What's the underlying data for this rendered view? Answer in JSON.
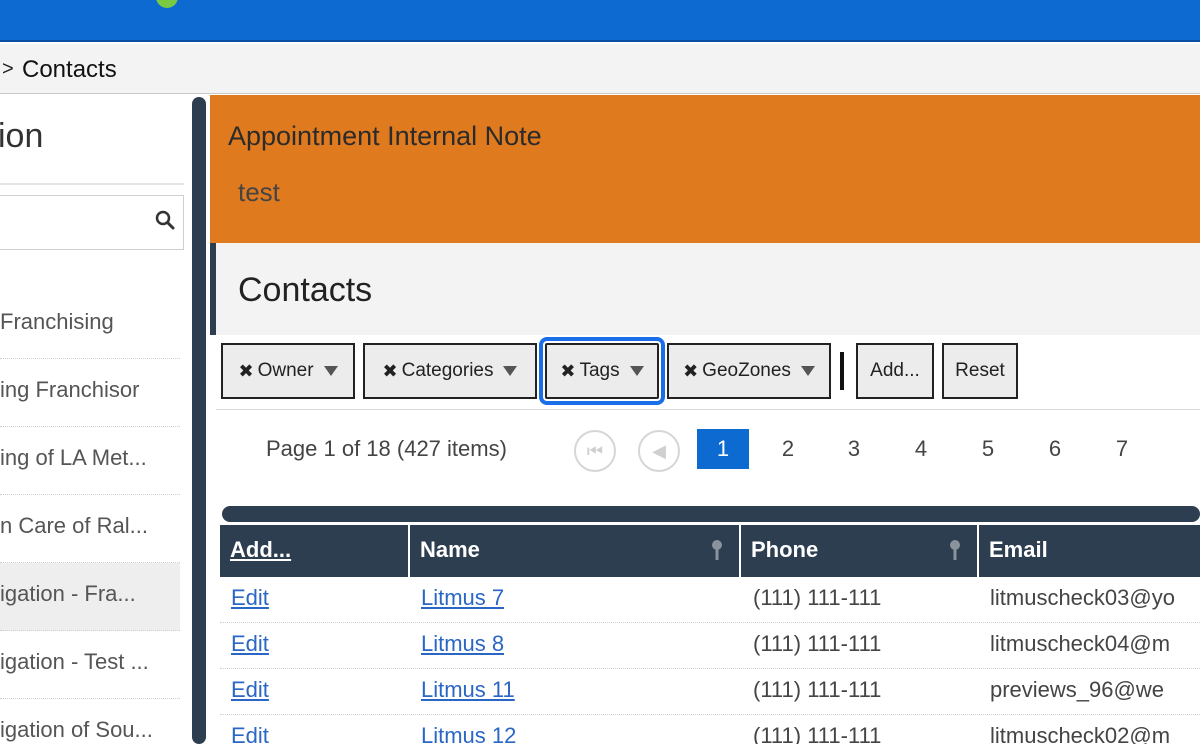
{
  "breadcrumb": {
    "separator": ">",
    "current": "Contacts"
  },
  "left_panel": {
    "title": "ion",
    "search": {
      "placeholder": ""
    },
    "items": [
      {
        "label": "Franchising"
      },
      {
        "label": "ing Franchisor"
      },
      {
        "label": "ing of LA Met..."
      },
      {
        "label": "n Care of Ral..."
      },
      {
        "label": "igation - Fra..."
      },
      {
        "label": "igation - Test ..."
      },
      {
        "label": "igation of Sou..."
      }
    ]
  },
  "notice": {
    "title": "Appointment Internal Note",
    "body": "test"
  },
  "contacts": {
    "title": "Contacts"
  },
  "filters": {
    "owner": "Owner",
    "categories": "Categories",
    "tags": "Tags",
    "geozones": "GeoZones",
    "add": "Add...",
    "reset": "Reset",
    "remove_glyph": "✖"
  },
  "pager": {
    "info": "Page 1 of 18 (427 items)",
    "first_glyph": "⏮",
    "prev_glyph": "◀",
    "pages": [
      "1",
      "2",
      "3",
      "4",
      "5",
      "6",
      "7"
    ],
    "current": "1"
  },
  "grid": {
    "columns": {
      "add": "Add...",
      "name": "Name",
      "phone": "Phone",
      "email": "Email"
    },
    "rows": [
      {
        "edit": "Edit",
        "name": "Litmus 7",
        "phone": "(111) 111-111",
        "email": "litmuscheck03@yo"
      },
      {
        "edit": "Edit",
        "name": "Litmus 8",
        "phone": "(111) 111-111",
        "email": "litmuscheck04@m"
      },
      {
        "edit": "Edit",
        "name": "Litmus 11",
        "phone": "(111) 111-111",
        "email": "previews_96@we"
      },
      {
        "edit": "Edit",
        "name": "Litmus 12",
        "phone": "(111) 111-111",
        "email": "litmuscheck02@m"
      }
    ]
  },
  "colors": {
    "topbar": "#0d6ad1",
    "notice": "#e07a1f",
    "grid_header": "#2d3e50",
    "accent": "#1a6ee8",
    "link": "#2a66c4"
  }
}
